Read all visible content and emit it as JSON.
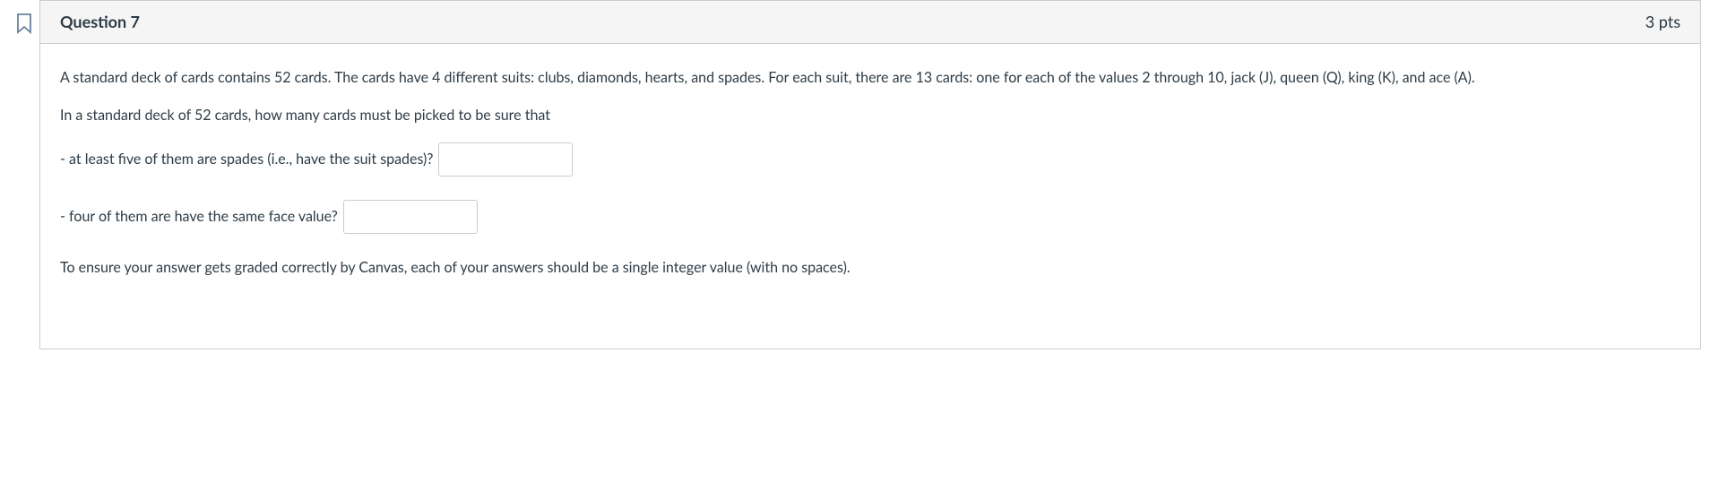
{
  "header": {
    "title": "Question 7",
    "points": "3 pts"
  },
  "body": {
    "intro": "A standard deck of cards contains 52 cards. The cards have 4 different suits: clubs, diamonds, hearts, and spades. For each suit, there are 13 cards: one for each of the values 2 through 10, jack (J), queen (Q), king (K), and ace (A).",
    "lead": "In a standard deck of 52 cards, how many cards must be picked to be sure that",
    "q1_label": "- at least five of them are spades (i.e., have the suit spades)?",
    "q2_label": "- four of them are have the same face value?",
    "note": "To ensure your answer gets graded correctly by Canvas, each of your answers should be a single integer value (with no spaces).",
    "q1_value": "",
    "q2_value": ""
  }
}
